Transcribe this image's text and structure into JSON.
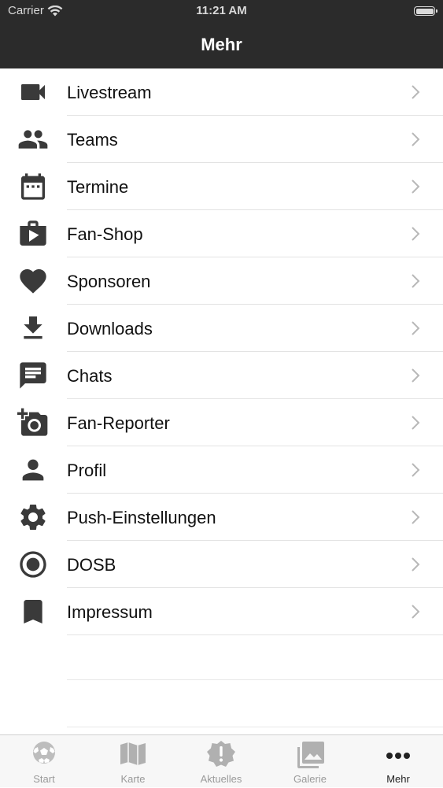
{
  "status_bar": {
    "carrier": "Carrier",
    "time": "11:21 AM"
  },
  "header": {
    "title": "Mehr"
  },
  "menu": {
    "items": [
      {
        "label": "Livestream",
        "icon": "video-camera-icon"
      },
      {
        "label": "Teams",
        "icon": "people-icon"
      },
      {
        "label": "Termine",
        "icon": "calendar-icon"
      },
      {
        "label": "Fan-Shop",
        "icon": "shopping-bag-icon"
      },
      {
        "label": "Sponsoren",
        "icon": "heart-icon"
      },
      {
        "label": "Downloads",
        "icon": "download-icon"
      },
      {
        "label": "Chats",
        "icon": "chat-icon"
      },
      {
        "label": "Fan-Reporter",
        "icon": "add-camera-icon"
      },
      {
        "label": "Profil",
        "icon": "person-icon"
      },
      {
        "label": "Push-Einstellungen",
        "icon": "gear-icon"
      },
      {
        "label": "DOSB",
        "icon": "radio-dot-icon"
      },
      {
        "label": "Impressum",
        "icon": "bookmark-icon"
      }
    ]
  },
  "tabbar": {
    "tabs": [
      {
        "label": "Start",
        "icon": "soccer-ball-icon"
      },
      {
        "label": "Karte",
        "icon": "map-icon"
      },
      {
        "label": "Aktuelles",
        "icon": "alert-badge-icon"
      },
      {
        "label": "Galerie",
        "icon": "gallery-icon"
      },
      {
        "label": "Mehr",
        "icon": "more-dots-icon"
      }
    ],
    "active": "Mehr"
  },
  "colors": {
    "header_bg": "#2b2b2b",
    "icon": "#3a3a3a",
    "inactive_tab": "#9a9a9a",
    "active_tab": "#222222"
  }
}
